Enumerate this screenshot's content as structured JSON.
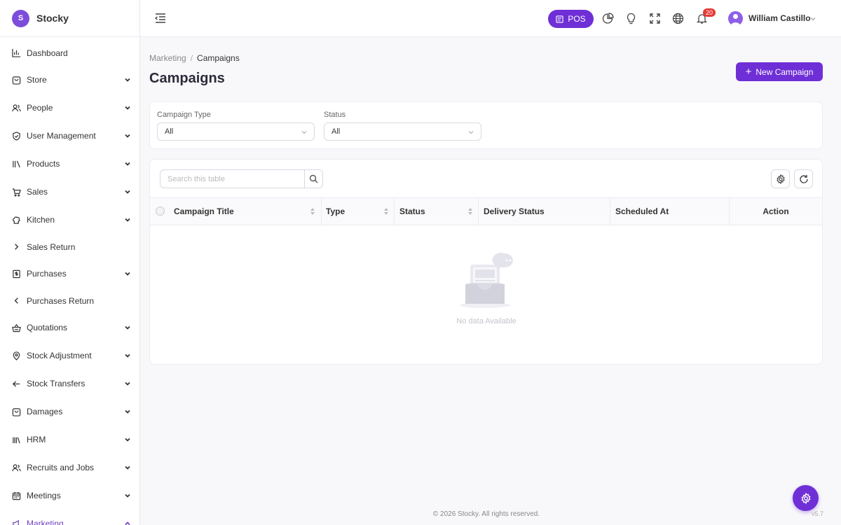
{
  "brand": {
    "name": "Stocky",
    "logo_letter": "S"
  },
  "sidebar": {
    "items": [
      {
        "label": "Dashboard",
        "icon": "bar-chart-icon",
        "chevron": "none"
      },
      {
        "label": "Store",
        "icon": "store-bag-icon",
        "chevron": "down"
      },
      {
        "label": "People",
        "icon": "people-icon",
        "chevron": "down"
      },
      {
        "label": "User Management",
        "icon": "shield-icon",
        "chevron": "down"
      },
      {
        "label": "Products",
        "icon": "books-icon",
        "chevron": "down"
      },
      {
        "label": "Sales",
        "icon": "cart-icon",
        "chevron": "down"
      },
      {
        "label": "Kitchen",
        "icon": "chef-hat-icon",
        "chevron": "down"
      },
      {
        "label": "Sales Return",
        "icon": "chevron-right-icon",
        "chevron": "none"
      },
      {
        "label": "Purchases",
        "icon": "receipt-icon",
        "chevron": "down"
      },
      {
        "label": "Purchases Return",
        "icon": "chevron-left-icon",
        "chevron": "none"
      },
      {
        "label": "Quotations",
        "icon": "basket-icon",
        "chevron": "down"
      },
      {
        "label": "Stock Adjustment",
        "icon": "location-pin-icon",
        "chevron": "down"
      },
      {
        "label": "Stock Transfers",
        "icon": "arrow-left-icon",
        "chevron": "down"
      },
      {
        "label": "Damages",
        "icon": "damage-bag-icon",
        "chevron": "down"
      },
      {
        "label": "HRM",
        "icon": "library-icon",
        "chevron": "down"
      },
      {
        "label": "Recruits and Jobs",
        "icon": "recruit-icon",
        "chevron": "down"
      },
      {
        "label": "Meetings",
        "icon": "calendar-icon",
        "chevron": "down"
      },
      {
        "label": "Marketing",
        "icon": "megaphone-icon",
        "chevron": "up"
      }
    ]
  },
  "topbar": {
    "pos_label": "POS",
    "notification_count": "20",
    "user_name": "William Castillo"
  },
  "breadcrumb": {
    "parent": "Marketing",
    "separator": "/",
    "current": "Campaigns"
  },
  "page": {
    "title": "Campaigns",
    "new_button": "New Campaign"
  },
  "filters": {
    "campaign_type": {
      "label": "Campaign Type",
      "value": "All"
    },
    "status": {
      "label": "Status",
      "value": "All"
    }
  },
  "table": {
    "search_placeholder": "Search this table",
    "columns": [
      "Campaign Title",
      "Type",
      "Status",
      "Delivery Status",
      "Scheduled At",
      "Action"
    ],
    "empty_text": "No data Available"
  },
  "footer": {
    "copyright": "© 2026 Stocky. All rights reserved.",
    "version": "v5.7"
  },
  "colors": {
    "accent": "#6f2fd6",
    "badge": "#e53935"
  }
}
